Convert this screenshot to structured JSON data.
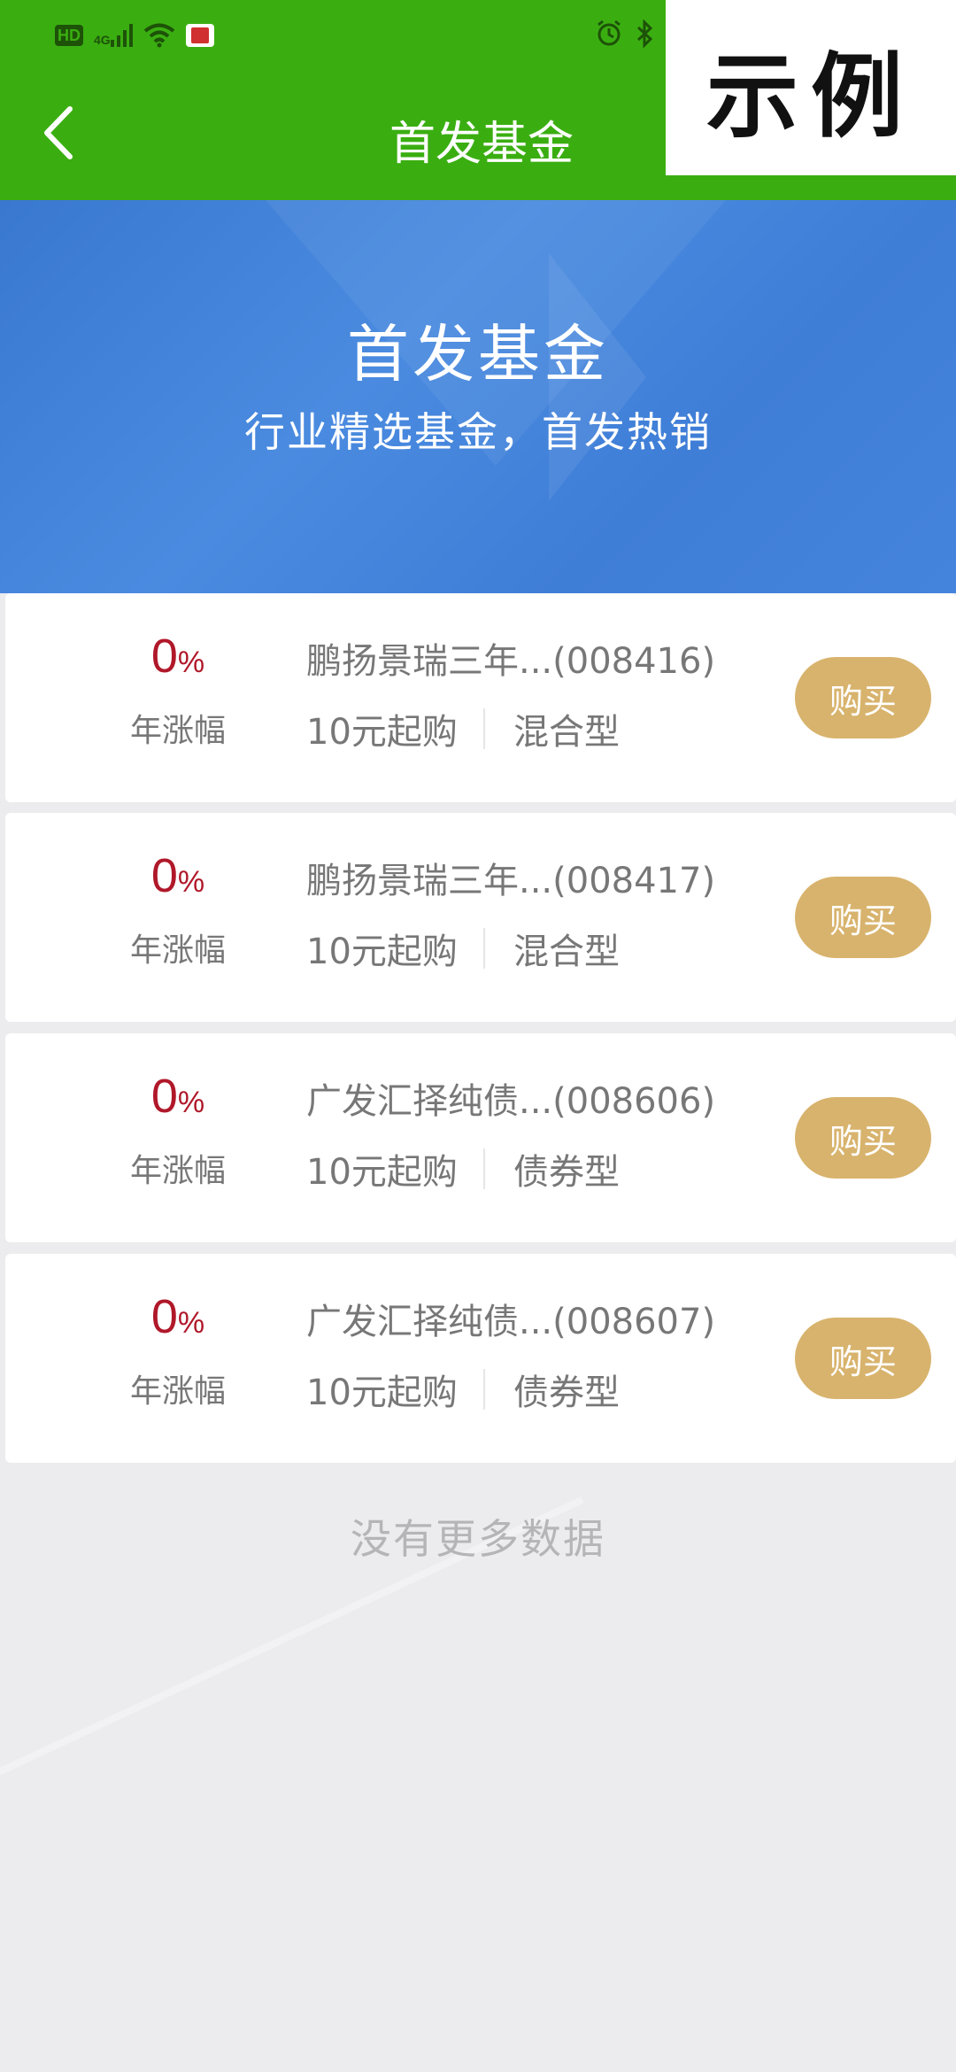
{
  "header": {
    "title": "首发基金",
    "watermark": "示例",
    "back_icon": "chevron-left-icon"
  },
  "status_bar": {
    "network": "4G",
    "hd": "HD",
    "icons": [
      "hd-icon",
      "signal-icon",
      "wifi-icon",
      "book-app-icon",
      "alarm-icon",
      "bluetooth-icon"
    ]
  },
  "banner": {
    "title": "首发基金",
    "subtitle": "行业精选基金，首发热销",
    "color": "#4584dc"
  },
  "colors": {
    "header_bg": "#3aae11",
    "rate_color": "#b0182a",
    "buy_button_bg": "#d8b36d",
    "page_bg": "#ececee"
  },
  "funds": [
    {
      "rate": "0",
      "rate_unit": "%",
      "rate_label": "年涨幅",
      "name": "鹏扬景瑞三年...(008416)",
      "min_purchase": "10元起购",
      "type": "混合型",
      "buy_label": "购买"
    },
    {
      "rate": "0",
      "rate_unit": "%",
      "rate_label": "年涨幅",
      "name": "鹏扬景瑞三年...(008417)",
      "min_purchase": "10元起购",
      "type": "混合型",
      "buy_label": "购买"
    },
    {
      "rate": "0",
      "rate_unit": "%",
      "rate_label": "年涨幅",
      "name": "广发汇择纯债...(008606)",
      "min_purchase": "10元起购",
      "type": "债券型",
      "buy_label": "购买"
    },
    {
      "rate": "0",
      "rate_unit": "%",
      "rate_label": "年涨幅",
      "name": "广发汇择纯债...(008607)",
      "min_purchase": "10元起购",
      "type": "债券型",
      "buy_label": "购买"
    }
  ],
  "footer": {
    "no_more": "没有更多数据"
  }
}
